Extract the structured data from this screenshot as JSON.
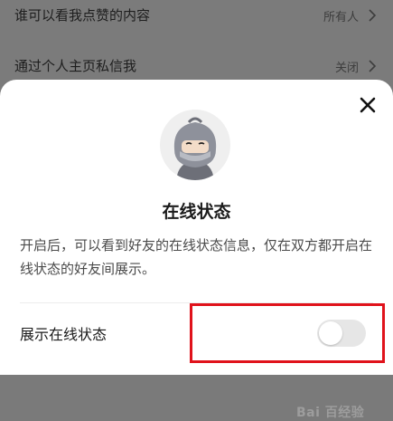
{
  "background_list": {
    "rows": [
      {
        "label": "谁可以看我点赞的内容",
        "value": "所有人"
      },
      {
        "label": "通过个人主页私信我",
        "value": "关闭"
      }
    ]
  },
  "sheet": {
    "title": "在线状态",
    "description": "开启后，可以看到好友的在线状态信息，仅在双方都开启在线状态的好友间展示。",
    "setting_label": "展示在线状态",
    "toggle_on": false,
    "close_icon": "close-icon",
    "avatar_icon": "ninja-avatar-icon"
  },
  "annotation": {
    "color": "#e0121b"
  },
  "watermark": "Bai 百经验"
}
